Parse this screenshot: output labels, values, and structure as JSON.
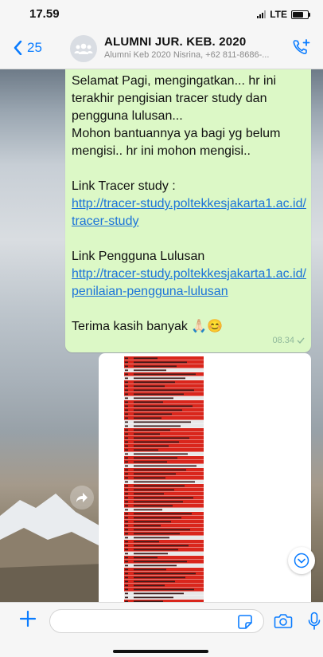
{
  "status": {
    "time": "17.59",
    "network": "LTE"
  },
  "header": {
    "back_count": "25",
    "title": "ALUMNI JUR. KEB. 2020",
    "subtitle": "Alumni Keb 2020 Nisrina, +62 811-8686-..."
  },
  "message": {
    "line1": "Selamat Pagi, mengingatkan... hr ini terakhir pengisian tracer study dan pengguna lulusan...",
    "line2": "Mohon bantuannya ya bagi yg belum mengisi.. hr ini mohon mengisi..",
    "tracer_label": "Link Tracer study :",
    "tracer_link": "http://tracer-study.poltekkesjakarta1.ac.id/tracer-study",
    "pengguna_label": "Link Pengguna Lulusan",
    "pengguna_link": "http://tracer-study.poltekkesjakarta1.ac.id/penilaian-pengguna-lulusan",
    "closing": "Terima kasih banyak 🙏🏻😊",
    "time": "08.34"
  },
  "composer": {
    "placeholder": ""
  },
  "colors": {
    "accent": "#0a7cff",
    "bubble": "#dcf8c6",
    "link": "#1b73d9",
    "sheet_red": "#d9261c"
  },
  "icons": [
    "back-chevron-icon",
    "group-avatar-icon",
    "add-call-icon",
    "forward-icon",
    "scroll-down-icon",
    "plus-icon",
    "sticker-icon",
    "camera-icon",
    "mic-icon"
  ]
}
